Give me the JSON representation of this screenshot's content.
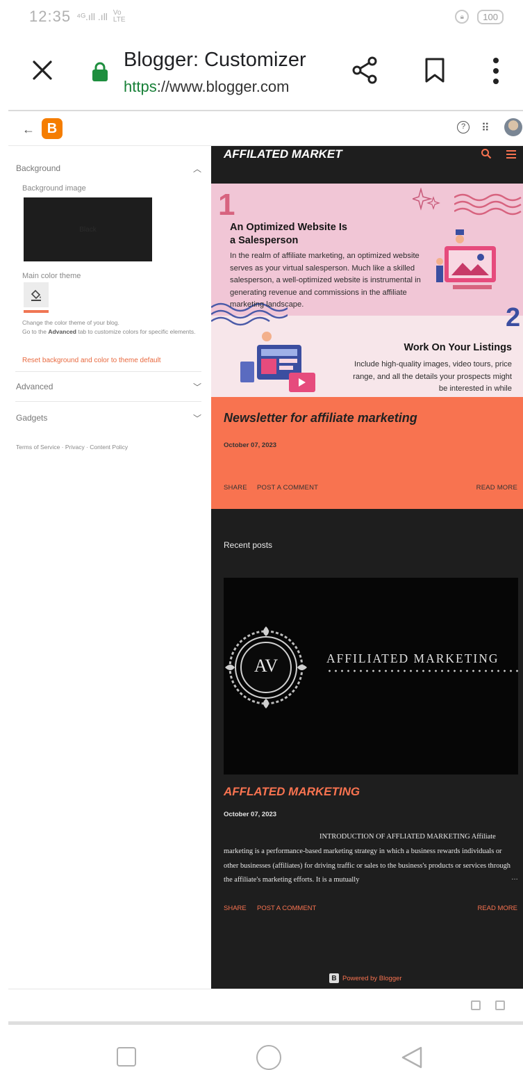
{
  "status_bar": {
    "time": "12:35",
    "signal": "⁴ᴳ.ıll .ıll",
    "network": "Vo LTE",
    "battery": "100"
  },
  "tab_bar": {
    "title": "Blogger: Customizer",
    "url_scheme": "https",
    "url_rest": "://www.blogger.com"
  },
  "blogger_header": {
    "logo_letter": "B",
    "help_symbol": "?"
  },
  "customizer": {
    "background_section": "Background",
    "background_image_label": "Background image",
    "background_image_preview_text": "Black",
    "main_color_theme_label": "Main color theme",
    "theme_help_line1": "Change the color theme of your blog.",
    "theme_help_prefix": "Go to the",
    "theme_help_bold": "Advanced",
    "theme_help_suffix": "tab to customize colors for specific elements.",
    "reset_link": "Reset background and color to theme default",
    "advanced_section": "Advanced",
    "gadgets_section": "Gadgets",
    "footer_links": "Terms of Service · Privacy · Content Policy",
    "accent_color": "#f07654"
  },
  "preview": {
    "site_title": "AFFILATED MARKET",
    "hero": {
      "number1": "1",
      "heading1_line1": "An Optimized Website Is",
      "heading1_line2": "a Salesperson",
      "paragraph1": "In the realm of affiliate marketing, an optimized website serves as your virtual salesperson. Much like a skilled salesperson, a well-optimized website is instrumental in generating revenue and commissions in the affiliate marketing landscape.",
      "number2": "2",
      "heading2": "Work On Your Listings",
      "paragraph2": "Include high-quality images, video tours, price range, and all the details your prospects might be interested in while"
    },
    "featured": {
      "title": "Newsletter for affiliate marketing",
      "date": "October 07, 2023",
      "share": "SHARE",
      "comment": "POST A COMMENT",
      "read_more": "READ MORE",
      "bg_color": "#f87350"
    },
    "recent_posts_heading": "Recent posts",
    "thumbnail": {
      "monogram": "AV",
      "brand_text": "AFFILIATED MARKETING"
    },
    "post": {
      "title": "AFFLATED MARKETING",
      "date": "October 07, 2023",
      "snippet": "INTRODUCTION OF  AFFLIATED MARKETING Affiliate marketing is a performance-based marketing strategy in which a business rewards individuals or other businesses (affiliates) for driving traffic or sales to the business's products or services through the affiliate's marketing efforts. It is a mutually",
      "ellipsis": "…",
      "share": "SHARE",
      "comment": "POST A COMMENT",
      "read_more": "READ MORE"
    },
    "powered_by": "Powered by Blogger",
    "powered_logo": "B"
  }
}
